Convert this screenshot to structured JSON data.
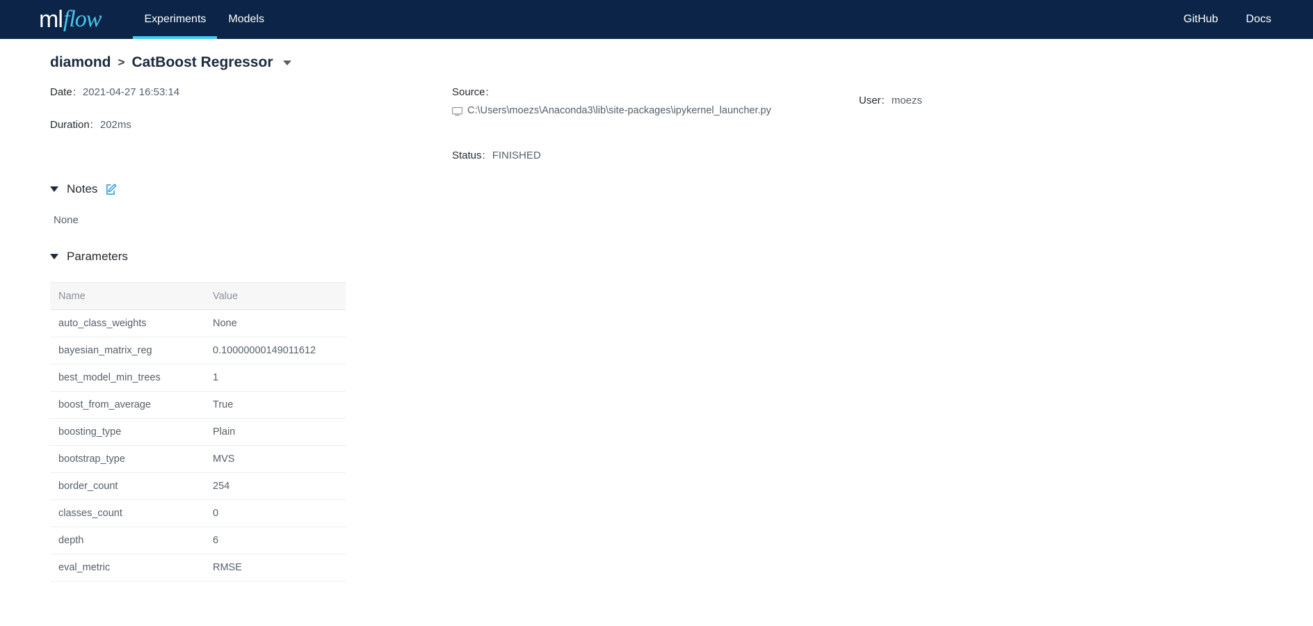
{
  "topnav": {
    "logo_ml": "ml",
    "logo_flow": "flow",
    "items": [
      {
        "label": "Experiments",
        "active": true
      },
      {
        "label": "Models",
        "active": false
      }
    ],
    "right_items": [
      {
        "label": "GitHub"
      },
      {
        "label": "Docs"
      }
    ],
    "background_color": "#0b2447",
    "accent_color": "#43c9ed"
  },
  "breadcrumb": {
    "experiment": "diamond",
    "separator": ">",
    "run_name": "CatBoost Regressor"
  },
  "run_meta": {
    "date_label": "Date",
    "date_value": "2021-04-27 16:53:14",
    "duration_label": "Duration",
    "duration_value": "202ms",
    "source_label": "Source",
    "source_value": "C:\\Users\\moezs\\Anaconda3\\lib\\site-packages\\ipykernel_launcher.py",
    "status_label": "Status",
    "status_value": "FINISHED",
    "user_label": "User",
    "user_value": "moezs",
    "colon": ":"
  },
  "notes": {
    "title": "Notes",
    "body": "None",
    "edit_icon": "edit-pencil-square-icon",
    "edit_icon_color": "#2596e0"
  },
  "parameters": {
    "title": "Parameters",
    "columns": [
      "Name",
      "Value"
    ],
    "rows": [
      {
        "name": "auto_class_weights",
        "value": "None"
      },
      {
        "name": "bayesian_matrix_reg",
        "value": "0.10000000149011612"
      },
      {
        "name": "best_model_min_trees",
        "value": "1"
      },
      {
        "name": "boost_from_average",
        "value": "True"
      },
      {
        "name": "boosting_type",
        "value": "Plain"
      },
      {
        "name": "bootstrap_type",
        "value": "MVS"
      },
      {
        "name": "border_count",
        "value": "254"
      },
      {
        "name": "classes_count",
        "value": "0"
      },
      {
        "name": "depth",
        "value": "6"
      },
      {
        "name": "eval_metric",
        "value": "RMSE"
      }
    ]
  }
}
